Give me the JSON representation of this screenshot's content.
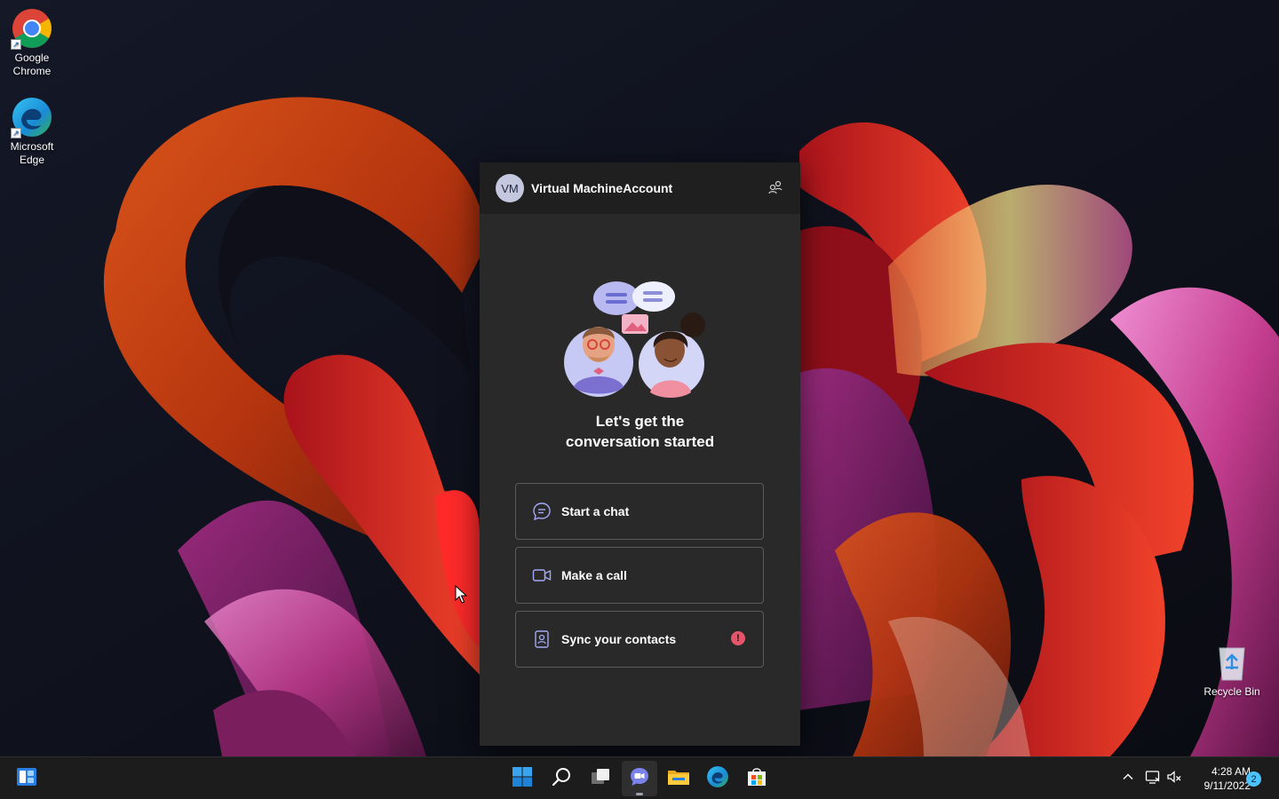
{
  "desktop": {
    "icons": [
      {
        "label": "Google Chrome",
        "icon": "chrome-icon"
      },
      {
        "label": "Microsoft Edge",
        "icon": "edge-icon"
      },
      {
        "label": "Recycle Bin",
        "icon": "recycle-bin-icon"
      }
    ]
  },
  "chat": {
    "account": {
      "initials": "VM",
      "name": "Virtual MachineAccount"
    },
    "headline_line1": "Let's get the",
    "headline_line2": "conversation started",
    "actions": [
      {
        "label": "Start a chat",
        "icon": "chat-bubble-icon"
      },
      {
        "label": "Make a call",
        "icon": "video-camera-icon"
      },
      {
        "label": "Sync your contacts",
        "icon": "contacts-icon",
        "alert": "!"
      }
    ]
  },
  "taskbar": {
    "apps": [
      "Widgets",
      "Start",
      "Search",
      "Task View",
      "Chat",
      "File Explorer",
      "Microsoft Edge",
      "Microsoft Store"
    ],
    "clock": {
      "time": "4:28 AM",
      "date": "9/11/2022"
    },
    "notification_count": "2"
  },
  "colors": {
    "flyout_bg": "#292929",
    "taskbar_bg": "#1c1c1c",
    "accent": "#4cc2ff",
    "alert": "#e3566a"
  }
}
